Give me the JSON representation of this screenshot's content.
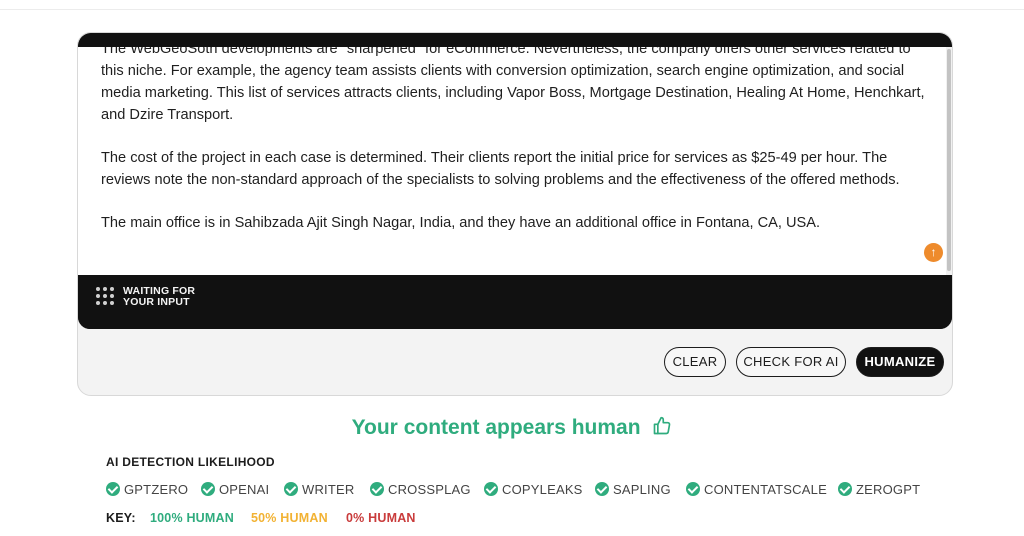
{
  "editor": {
    "paragraphs": [
      "The WebGeoSoth developments are \"sharpened\" for eCommerce. Nevertheless, the company offers other services related to this niche. For example, the agency team assists clients with conversion optimization, search engine optimization, and social media marketing. This list of services attracts clients, including Vapor Boss, Mortgage Destination, Healing At Home, Henchkart, and Dzire Transport.",
      "The cost of the project in each case is determined. Their clients report the initial price for services as $25-49 per hour. The reviews note the non-standard approach of the specialists to solving problems and the effectiveness of the offered methods.",
      "The main office is in Sahibzada Ajit Singh Nagar, India, and they have an additional office in Fontana, CA, USA."
    ],
    "status_line1": "WAITING FOR",
    "status_line2": "YOUR INPUT"
  },
  "buttons": {
    "clear": "CLEAR",
    "check": "CHECK FOR AI",
    "humanize": "HUMANIZE"
  },
  "result": {
    "message": "Your content appears human",
    "icon": "thumbs-up-icon"
  },
  "detection": {
    "title": "AI DETECTION LIKELIHOOD",
    "detectors": [
      "GPTZERO",
      "OPENAI",
      "WRITER",
      "CROSSPLAG",
      "COPYLEAKS",
      "SAPLING",
      "CONTENTATSCALE",
      "ZEROGPT"
    ]
  },
  "key": {
    "label": "KEY:",
    "items": [
      {
        "text": "100% HUMAN",
        "color": "#2fac7e"
      },
      {
        "text": "50% HUMAN",
        "color": "#f2b233"
      },
      {
        "text": "0% HUMAN",
        "color": "#c93b3b"
      }
    ]
  },
  "colors": {
    "accent_green": "#2fac7e",
    "dark": "#111111",
    "orange": "#ee8b2c"
  }
}
